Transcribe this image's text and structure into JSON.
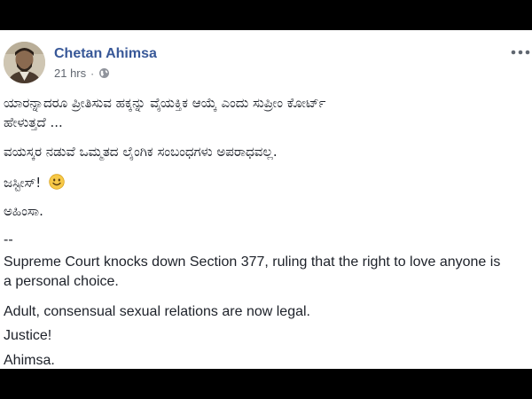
{
  "post": {
    "author": "Chetan Ahimsa",
    "timestamp": "21 hrs",
    "dot": "·",
    "privacy_icon": "globe-icon",
    "more_icon": "more-options-icon",
    "lines": {
      "kn1a": "ಯಾರನ್ನಾದರೂ ಪ್ರೀತಿಸುವ ಹಕ್ಕನ್ನು ವೈಯಕ್ತಿಕ ಆಯ್ಕೆ ಎಂದು ಸುಪ್ರೀಂ ಕೋರ್ಟ್",
      "kn1b": "ಹೇಳುತ್ತದೆ ...",
      "kn2": "ವಯಸ್ಕರ ನಡುವೆ ಒಮ್ಮತದ ಲೈಂಗಿಕ ಸಂಬಂಧಗಳು ಅಪರಾಧವಲ್ಲ.",
      "kn3": "ಜಸ್ಟೀಸ್!",
      "kn4": "ಅಹಿಂಸಾ.",
      "sep": "--",
      "en1a": "Supreme Court knocks down Section 377, ruling that the right to love anyone is",
      "en1b": "a personal choice.",
      "en2": "Adult, consensual sexual relations are now legal.",
      "en3": "Justice!",
      "en4": "Ahimsa."
    },
    "emoji_icon": "smiley-emoji-icon"
  },
  "colors": {
    "author": "#385898",
    "meta": "#616770",
    "text": "#1d2129",
    "background": "#ffffff",
    "letterbox": "#000000"
  }
}
